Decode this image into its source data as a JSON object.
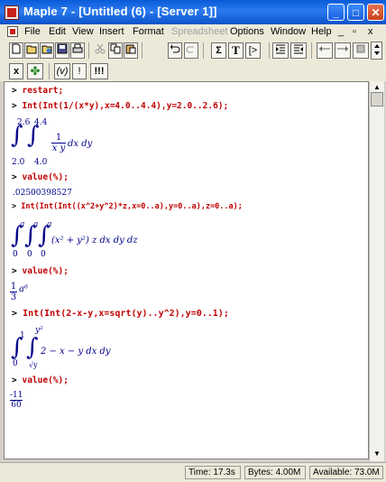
{
  "window": {
    "title": "Maple 7  - [Untitled (6) - [Server 1]]",
    "min_glyph": "_",
    "max_glyph": "□",
    "close_glyph": "✕"
  },
  "menu": {
    "items": [
      "File",
      "Edit",
      "View",
      "Insert",
      "Format",
      "Spreadsheet",
      "Options",
      "Window",
      "Help"
    ],
    "min_glyph": "_",
    "restore_glyph": "▫",
    "close_glyph": "x"
  },
  "toolbar1": {
    "buttons": [
      "new-icon",
      "open-icon",
      "open-url-icon",
      "save-icon",
      "print-icon",
      "cut-icon",
      "copy-icon",
      "paste-icon",
      "undo-icon",
      "redo-icon",
      "sigma-icon",
      "text-icon",
      "prompt-icon",
      "indent-icon",
      "outdent-icon",
      "back-icon",
      "forward-icon",
      "stop-icon"
    ],
    "sigma": "Σ",
    "text": "T",
    "prompt": "[>"
  },
  "toolbar2": {
    "symbol_label": "x",
    "palette_label": "✤",
    "paren_label": "(v)",
    "exclaim_label": "!",
    "execute_label": "!!!"
  },
  "worksheet": {
    "prompt": ">",
    "cmd1": "restart;",
    "cmd2": "Int(Int(1/(x*y),x=4.0..4.4),y=2.0..2.6);",
    "out2": {
      "upper_outer": "2.6",
      "lower_outer": "2.0",
      "upper_inner": "4.4",
      "lower_inner": "4.0",
      "numer": "1",
      "denom": "x y",
      "diff": "dx dy"
    },
    "cmd3": "value(%);",
    "out3": ".02500398527",
    "cmd4": "Int(Int(Int((x^2+y^2)*z,x=0..a),y=0..a),z=0..a);",
    "out4": {
      "upper1": "a",
      "lower1": "0",
      "upper2": "a",
      "lower2": "0",
      "upper3": "a",
      "lower3": "0",
      "integrand": "(x² + y²) z dx dy dz"
    },
    "cmd5": "value(%);",
    "out5": {
      "numer": "1",
      "denom": "3",
      "tail": "a⁶"
    },
    "cmd6": "Int(Int(2-x-y,x=sqrt(y)..y^2),y=0..1);",
    "out6": {
      "upper_outer": "1",
      "lower_outer": "0",
      "upper_inner": "y²",
      "lower_inner": "√y",
      "integrand": "2 − x − y dx dy"
    },
    "cmd7": "value(%);",
    "out7": {
      "numer": "-11",
      "denom": "60"
    }
  },
  "scroll": {
    "up": "▲",
    "down": "▼"
  },
  "status": {
    "time": "Time: 17.3s",
    "bytes": "Bytes: 4.00M",
    "available": "Available: 73.0M"
  }
}
